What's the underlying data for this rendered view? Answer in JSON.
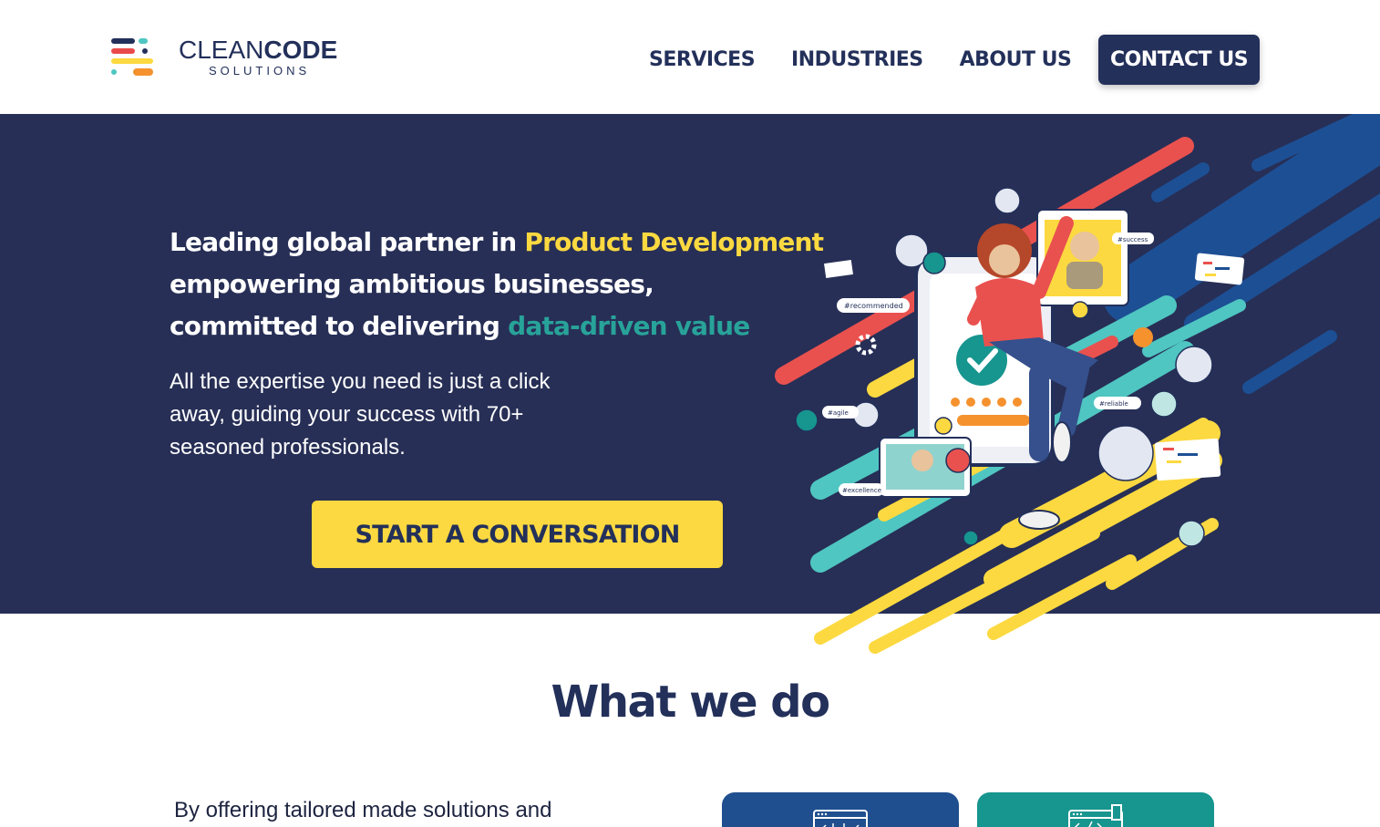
{
  "header": {
    "logo": {
      "line1_light": "CLEAN",
      "line1_bold": "CODE",
      "line2": "SOLUTIONS"
    },
    "nav": [
      {
        "label": "SERVICES"
      },
      {
        "label": "INDUSTRIES"
      },
      {
        "label": "ABOUT US"
      }
    ],
    "contact_label": "CONTACT US"
  },
  "hero": {
    "title_part1": "Leading global partner in ",
    "title_highlight1": "Product Development",
    "title_part2": "empowering ambitious businesses,",
    "title_part3": "committed to delivering ",
    "title_highlight2": "data-driven value",
    "subtitle": "All the expertise you need is just a click away, guiding your success with 70+ seasoned professionals.",
    "cta_label": "START A CONVERSATION",
    "illustration_tags": [
      "#recommended",
      "#success",
      "#agile",
      "#reliable",
      "#excellence"
    ]
  },
  "section": {
    "title": "What we do",
    "intro": "By offering tailored made solutions and"
  },
  "colors": {
    "navy": "#23305a",
    "hero_bg": "#272f56",
    "yellow": "#fcd940",
    "teal": "#28a39a",
    "blue_card": "#1f4f8f",
    "teal_card": "#17958f"
  }
}
